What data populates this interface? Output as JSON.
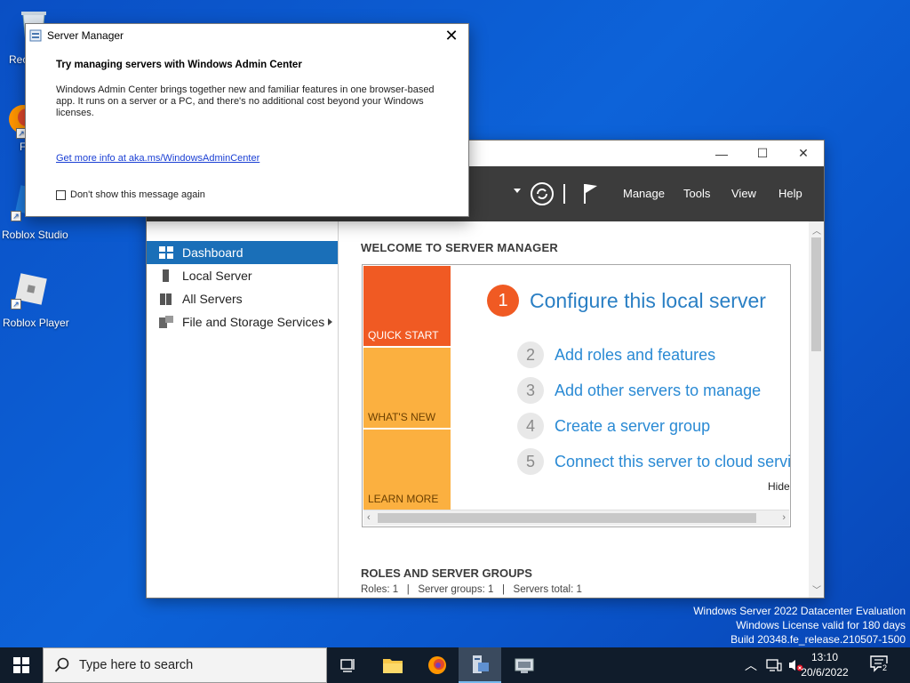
{
  "desktop": {
    "icons": [
      {
        "label": "Rec",
        "icon": "recycle-bin-icon"
      },
      {
        "label": "F",
        "icon": "firefox-icon"
      },
      {
        "label": "Roblox Studio",
        "icon": "roblox-studio-icon"
      },
      {
        "label": "Roblox Player",
        "icon": "roblox-player-icon"
      }
    ]
  },
  "popup": {
    "title": "Server Manager",
    "heading": "Try managing servers with Windows Admin Center",
    "body": "Windows Admin Center brings together new and familiar features in one browser-based app. It runs on a server or a PC, and there's no additional cost beyond your Windows licenses.",
    "link": "Get more info at aka.ms/WindowsAdminCenter",
    "checkbox_label": "Don't show this message again",
    "checkbox_checked": false
  },
  "server_manager": {
    "controls": {
      "minimize": "—",
      "maximize": "☐",
      "close": "✕"
    },
    "menus": [
      "Manage",
      "Tools",
      "View",
      "Help"
    ],
    "nav": [
      {
        "label": "Dashboard",
        "icon": "dashboard-icon",
        "selected": true
      },
      {
        "label": "Local Server",
        "icon": "local-server-icon"
      },
      {
        "label": "All Servers",
        "icon": "all-servers-icon"
      },
      {
        "label": "File and Storage Services",
        "icon": "file-storage-icon",
        "has_arrow": true
      }
    ],
    "welcome_title": "WELCOME TO SERVER MANAGER",
    "tiles": [
      {
        "label": "QUICK START",
        "color": "#f05a23"
      },
      {
        "label": "WHAT'S NEW",
        "color": "#fbb040"
      },
      {
        "label": "LEARN MORE",
        "color": "#fbb040"
      }
    ],
    "steps": [
      {
        "num": "1",
        "text": "Configure this local server"
      },
      {
        "num": "2",
        "text": "Add roles and features"
      },
      {
        "num": "3",
        "text": "Add other servers to manage"
      },
      {
        "num": "4",
        "text": "Create a server group"
      },
      {
        "num": "5",
        "text": "Connect this server to cloud services"
      }
    ],
    "hide_label": "Hide",
    "roles_title": "ROLES AND SERVER GROUPS",
    "roles_summary": "Roles: 1   |   Server groups: 1   |   Servers total: 1"
  },
  "watermark": {
    "line1": "Windows Server 2022 Datacenter Evaluation",
    "line2": "Windows License valid for 180 days",
    "line3": "Build 20348.fe_release.210507-1500"
  },
  "taskbar": {
    "search_placeholder": "Type here to search",
    "clock_time": "13:10",
    "clock_date": "20/6/2022",
    "notification_count": "2"
  },
  "colors": {
    "accent": "#1a6fb8",
    "orange": "#f05a23",
    "step_blue": "#2a8ad4"
  }
}
